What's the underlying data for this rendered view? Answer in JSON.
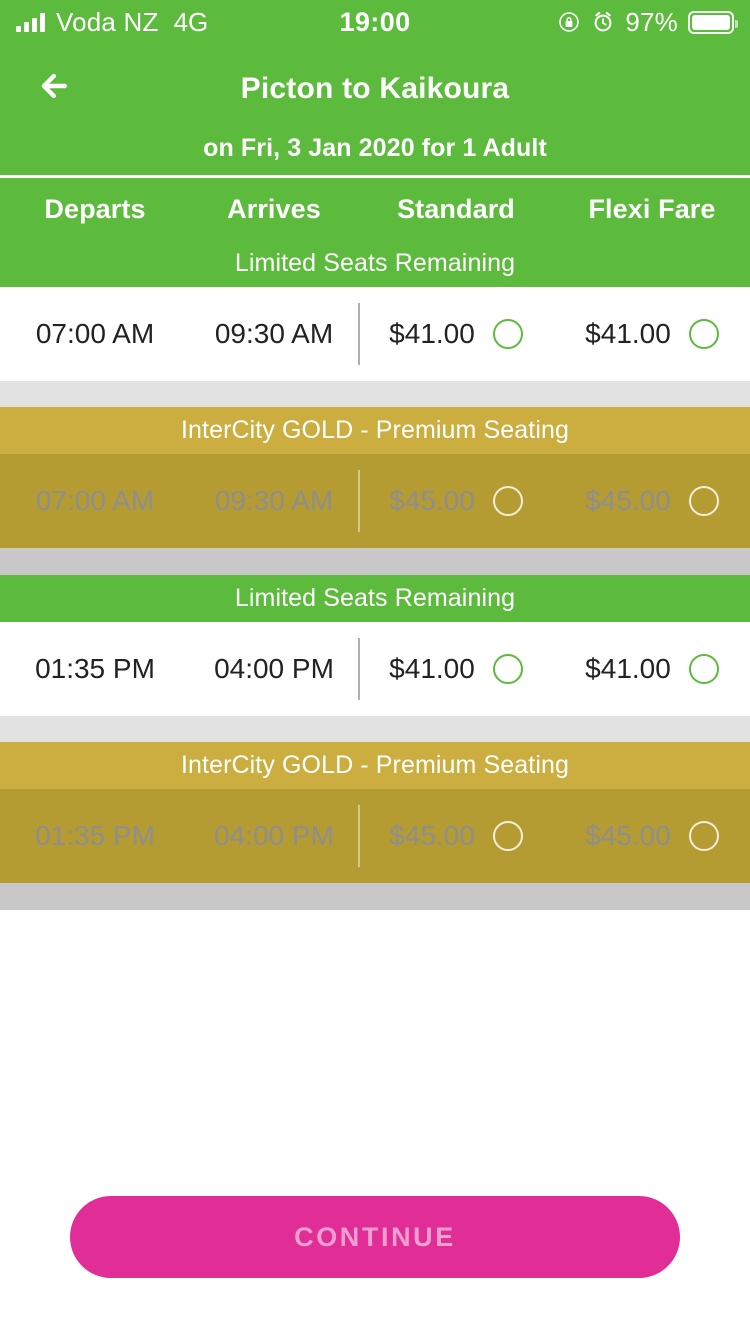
{
  "status_bar": {
    "carrier": "Voda NZ",
    "network": "4G",
    "time": "19:00",
    "battery_percent": "97%",
    "icons": [
      "signal-bars-icon",
      "rotation-lock-icon",
      "alarm-clock-icon",
      "battery-icon"
    ]
  },
  "header": {
    "back_icon": "back-arrow-icon",
    "title": "Picton to Kaikoura",
    "subtitle": "on Fri, 3 Jan 2020 for 1 Adult",
    "background_color": "#5CBA3C"
  },
  "columns": {
    "departs": "Departs",
    "arrives": "Arrives",
    "standard": "Standard",
    "flexi": "Flexi Fare"
  },
  "banners": {
    "limited": "Limited Seats Remaining",
    "gold": "InterCity GOLD - Premium Seating"
  },
  "services": [
    {
      "banner": "Limited Seats Remaining",
      "banner_type": "green",
      "departs": "07:00 AM",
      "arrives": "09:30 AM",
      "standard_price": "$41.00",
      "flexi_price": "$41.00",
      "disabled": false
    },
    {
      "banner": "InterCity GOLD - Premium Seating",
      "banner_type": "gold",
      "departs": "07:00 AM",
      "arrives": "09:30 AM",
      "standard_price": "$45.00",
      "flexi_price": "$45.00",
      "disabled": true
    },
    {
      "banner": "Limited Seats Remaining",
      "banner_type": "green",
      "departs": "01:35 PM",
      "arrives": "04:00 PM",
      "standard_price": "$41.00",
      "flexi_price": "$41.00",
      "disabled": false
    },
    {
      "banner": "InterCity GOLD - Premium Seating",
      "banner_type": "gold",
      "departs": "01:35 PM",
      "arrives": "04:00 PM",
      "standard_price": "$45.00",
      "flexi_price": "$45.00",
      "disabled": true
    }
  ],
  "footer": {
    "continue_label": "CONTINUE",
    "continue_color": "#E12D96",
    "continue_text_color": "#F09FD0"
  },
  "colors": {
    "green": "#5CBA3C",
    "gold_banner": "#CBAE3F",
    "gold_row": "#B49B32",
    "separator_light": "#E2E2E2",
    "separator_grey": "#C8C8C8"
  }
}
